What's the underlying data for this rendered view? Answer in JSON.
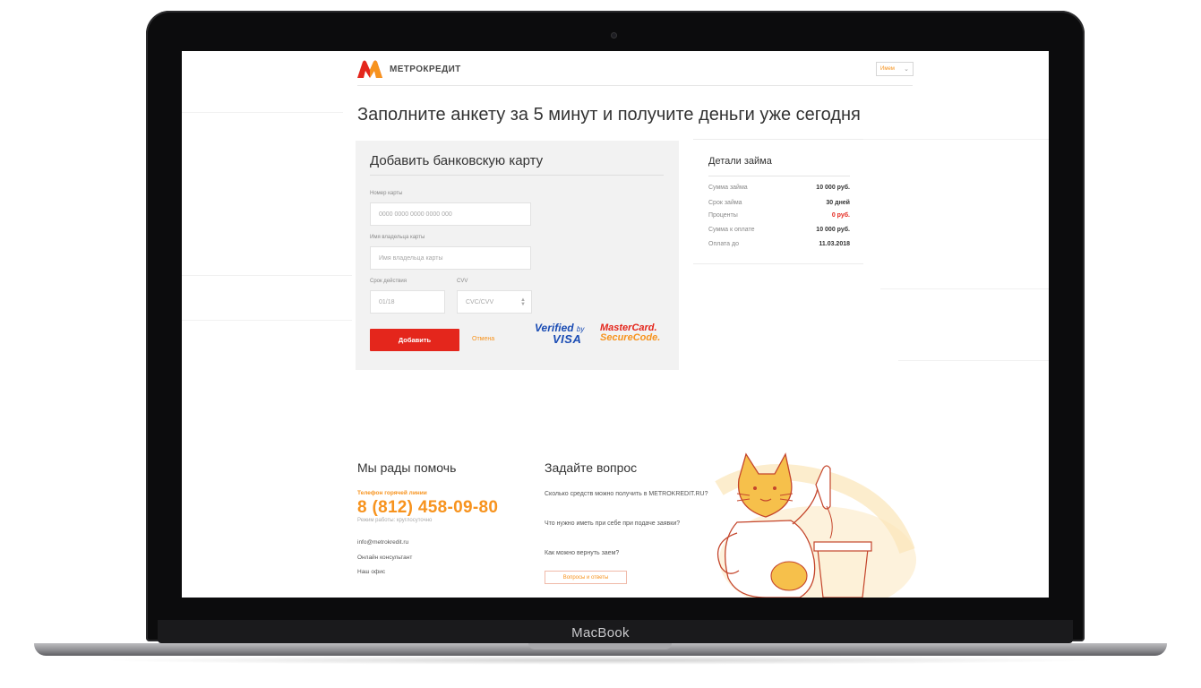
{
  "device": {
    "label": "MacBook"
  },
  "header": {
    "logo_text": "МЕТРОКРЕДИТ",
    "language": "Имем",
    "brand_colors": {
      "red": "#e4261c",
      "orange": "#f7931e"
    }
  },
  "page_title": "Заполните анкету за 5 минут и получите деньги уже сегодня",
  "card_form": {
    "title": "Добавить банковскую карту",
    "card_number_label": "Номер карты",
    "card_number_placeholder": "0000 0000 0000 0000 000",
    "holder_label": "Имя владельца карты",
    "holder_placeholder": "Имя владельца карты",
    "expiry_label": "Срок действия",
    "expiry_value": "01/18",
    "cvv_label": "CVV",
    "cvv_placeholder": "CVC/CVV",
    "add_button": "Добавить",
    "cancel_link": "Отмена",
    "badge_visa_line1": "Verified",
    "badge_visa_by": "by",
    "badge_visa_line2": "VISA",
    "badge_mc_line1": "MasterCard.",
    "badge_mc_line2": "SecureCode."
  },
  "loan_details": {
    "title": "Детали займа",
    "rows": [
      {
        "label": "Сумма займа",
        "value": "10 000 руб."
      },
      {
        "label": "Срок займа",
        "value": "30 дней"
      },
      {
        "label": "Проценты",
        "value": "0 руб."
      },
      {
        "label": "Сумма к оплате",
        "value": "10 000 руб."
      },
      {
        "label": "Оплата до",
        "value": "11.03.2018"
      }
    ]
  },
  "help": {
    "title": "Мы рады помочь",
    "hotline_label": "Телефон горячей линии",
    "phone": "8 (812) 458-09-80",
    "hours": "Режим работы: круглосуточно",
    "links": [
      "info@metrokredit.ru",
      "Онлайн консультант",
      "Наш офис"
    ]
  },
  "faq": {
    "title": "Задайте вопрос",
    "questions": [
      "Сколько средств можно получить в METROKREDIT.RU?",
      "Что нужно иметь при себе при подаче заявки?",
      "Как можно вернуть заем?"
    ],
    "button": "Вопросы и ответы"
  }
}
